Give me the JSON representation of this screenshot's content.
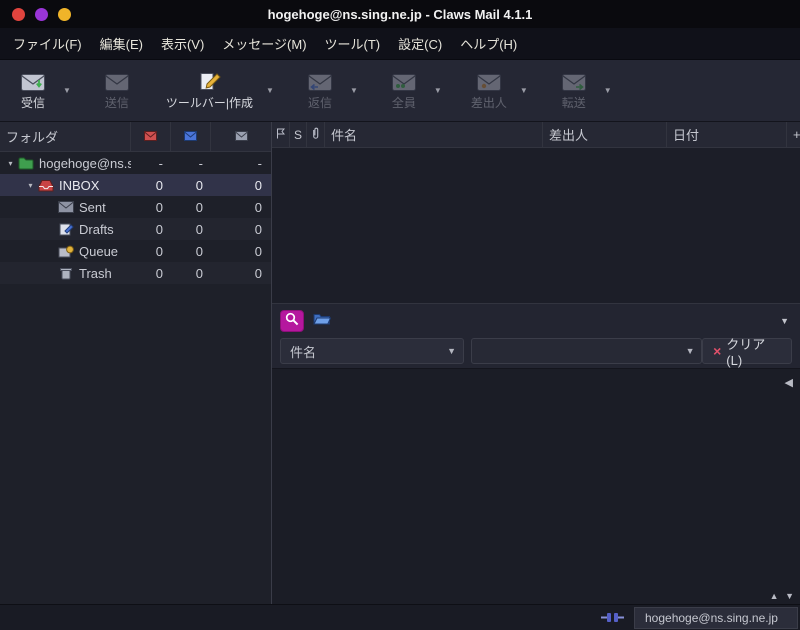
{
  "window": {
    "title": "hogehoge@ns.sing.ne.jp - Claws Mail 4.1.1"
  },
  "menubar": {
    "items": [
      {
        "label": "ファイル(F)"
      },
      {
        "label": "編集(E)"
      },
      {
        "label": "表示(V)"
      },
      {
        "label": "メッセージ(M)"
      },
      {
        "label": "ツール(T)"
      },
      {
        "label": "設定(C)"
      },
      {
        "label": "ヘルプ(H)"
      }
    ]
  },
  "toolbar": {
    "buttons": [
      {
        "id": "receive",
        "label": "受信",
        "enabled": true,
        "dropdown": true
      },
      {
        "id": "send",
        "label": "送信",
        "enabled": false,
        "dropdown": false
      },
      {
        "id": "compose",
        "label": "ツールバー|作成",
        "enabled": true,
        "dropdown": true
      },
      {
        "id": "reply",
        "label": "返信",
        "enabled": false,
        "dropdown": true
      },
      {
        "id": "reply-all",
        "label": "全員",
        "enabled": false,
        "dropdown": true
      },
      {
        "id": "reply-sender",
        "label": "差出人",
        "enabled": false,
        "dropdown": true
      },
      {
        "id": "forward",
        "label": "転送",
        "enabled": false,
        "dropdown": true
      }
    ]
  },
  "folder_pane": {
    "header_label": "フォルダ",
    "rows": [
      {
        "name": "hogehoge@ns.sing.ne.jp",
        "new": "-",
        "unread": "-",
        "total": "-"
      },
      {
        "name": "INBOX",
        "new": "0",
        "unread": "0",
        "total": "0"
      },
      {
        "name": "Sent",
        "new": "0",
        "unread": "0",
        "total": "0"
      },
      {
        "name": "Drafts",
        "new": "0",
        "unread": "0",
        "total": "0"
      },
      {
        "name": "Queue",
        "new": "0",
        "unread": "0",
        "total": "0"
      },
      {
        "name": "Trash",
        "new": "0",
        "unread": "0",
        "total": "0"
      }
    ]
  },
  "message_list": {
    "status_col": "S",
    "subject_col": "件名",
    "from_col": "差出人",
    "date_col": "日付",
    "add_col": "+"
  },
  "quick_search": {
    "field_selector": "件名",
    "search_value": "",
    "clear_label": "クリア(L)"
  },
  "statusbar": {
    "account": "hogehoge@ns.sing.ne.jp"
  },
  "icons": {
    "dropdown_arrow": "▼",
    "expander_open": "▾",
    "collapse_left": "◀",
    "scroll_up": "▲",
    "scroll_down": "▼",
    "clear_x": "×"
  },
  "colors": {
    "accent_magenta": "#b5179e",
    "titlebar_red": "#e0443e",
    "titlebar_purple": "#9a35d8",
    "titlebar_yellow": "#f0b429",
    "selection": "#313349"
  }
}
